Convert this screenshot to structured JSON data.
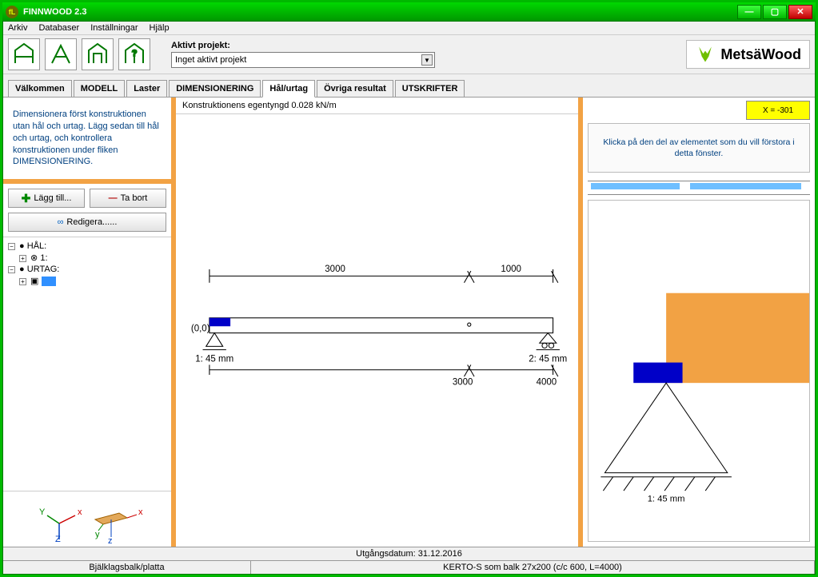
{
  "window": {
    "title": "FINNWOOD 2.3"
  },
  "menu": {
    "arkiv": "Arkiv",
    "databaser": "Databaser",
    "installningar": "Inställningar",
    "hjalp": "Hjälp"
  },
  "project": {
    "label": "Aktivt projekt:",
    "value": "Inget aktivt projekt"
  },
  "brand": {
    "text": "MetsäWood"
  },
  "tabs": {
    "valkommen": "Välkommen",
    "modell": "MODELL",
    "laster": "Laster",
    "dimensionering": "DIMENSIONERING",
    "halurtag": "Hål/urtag",
    "ovriga": "Övriga resultat",
    "utskrifter": "UTSKRIFTER"
  },
  "sidebar": {
    "instruction": "Dimensionera först konstruktionen utan hål och urtag. Lägg sedan till hål och urtag, och kontrollera konstruktionen under fliken DIMENSIONERING.",
    "add": "Lägg till...",
    "remove": "Ta bort",
    "edit": "Redigera......",
    "tree": {
      "hal": "HÅL:",
      "item1": "1:",
      "urtag": "URTAG:"
    }
  },
  "canvas": {
    "self_weight": "Konstruktionens egentyngd 0.028 kN/m",
    "origin": "(0,0)",
    "dim_top_left": "3000",
    "dim_top_right": "1000",
    "sup1": "1: 45 mm",
    "sup2": "2: 45 mm",
    "coord_bottom_left": "3000",
    "coord_bottom_right": "4000"
  },
  "right": {
    "coord": "X = -301",
    "hint": "Klicka på den del av elementet som du vill förstora i detta fönster.",
    "detail_label": "1: 45 mm"
  },
  "status": {
    "date": "Utgångsdatum: 31.12.2016",
    "type": "Bjälklagsbalk/platta",
    "product": "KERTO-S som balk 27x200 (c/c 600, L=4000)"
  }
}
